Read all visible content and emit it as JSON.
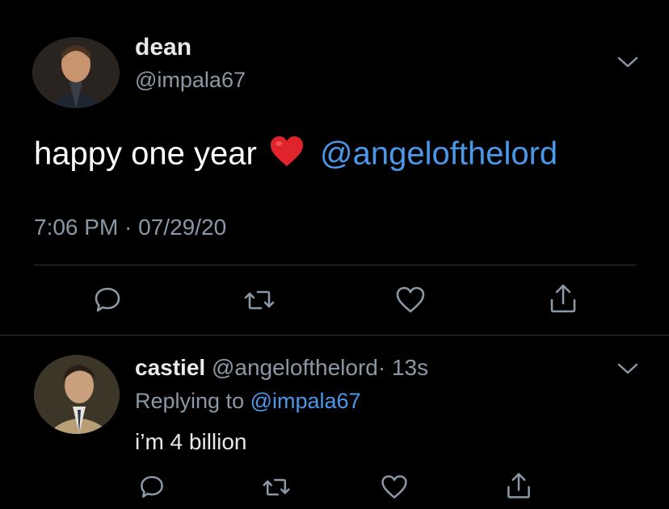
{
  "main_tweet": {
    "name": "dean",
    "handle": "@impala67",
    "text_prefix": "happy one year",
    "mention": "@angelofthelord",
    "timestamp": "7:06 PM · 07/29/20"
  },
  "reply": {
    "name": "castiel",
    "handle": "@angelofthelord",
    "time": "· 13s",
    "replying_prefix": "Replying to",
    "replying_to": "@impala67",
    "text": "i’m 4 billion"
  },
  "icons": {
    "more": "chevron-down-icon",
    "reply": "comment-icon",
    "retweet": "retweet-icon",
    "like": "heart-outline-icon",
    "share": "share-icon",
    "emoji": "red-heart-emoji"
  },
  "colors": {
    "background": "#000000",
    "mention": "#4a98e9",
    "muted": "#8b98a5",
    "emoji_heart": "#e0242c"
  }
}
